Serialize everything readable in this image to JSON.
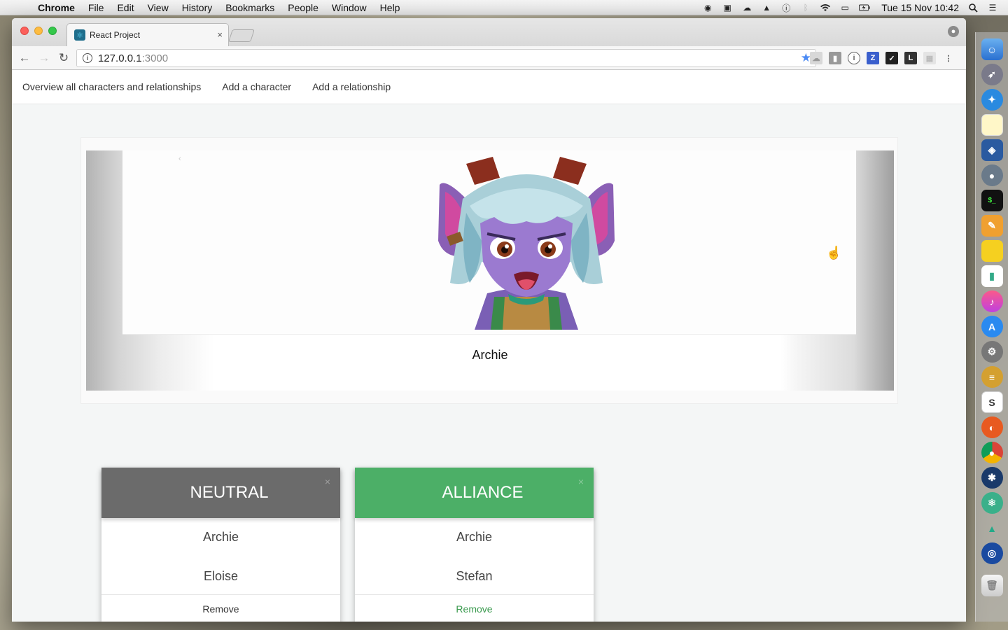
{
  "menubar": {
    "app_name": "Chrome",
    "items": [
      "File",
      "Edit",
      "View",
      "History",
      "Bookmarks",
      "People",
      "Window",
      "Help"
    ],
    "clock": "Tue 15 Nov  10:42"
  },
  "browser": {
    "tab_title": "React Project",
    "url_host": "127.0.0.1",
    "url_port": ":3000"
  },
  "nav": {
    "overview": "Overview all characters and relationships",
    "add_character": "Add a character",
    "add_relationship": "Add a relationship"
  },
  "carousel": {
    "prev_arrow": "‹",
    "next_arrow": "›",
    "current_character": "Archie"
  },
  "relationships": [
    {
      "type": "NEUTRAL",
      "color": "#6b6b6b",
      "members": [
        "Archie",
        "Eloise"
      ],
      "remove_label": "Remove",
      "remove_color": "#333333"
    },
    {
      "type": "ALLIANCE",
      "color": "#4caf67",
      "members": [
        "Archie",
        "Stefan"
      ],
      "remove_label": "Remove",
      "remove_color": "#3a9a4e"
    }
  ],
  "icons": {
    "close": "×"
  }
}
